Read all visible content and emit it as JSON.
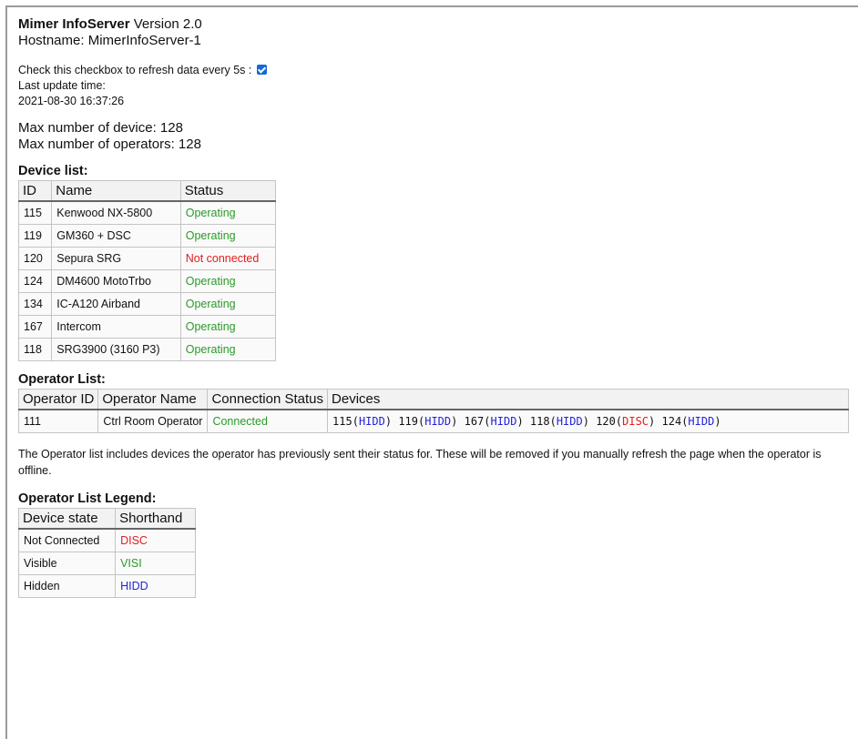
{
  "header": {
    "product": "Mimer InfoServer",
    "version": "Version 2.0",
    "hostname": "Hostname: MimerInfoServer-1"
  },
  "refresh": {
    "label": "Check this checkbox to refresh data every 5s :",
    "checked": true,
    "last_update_label": "Last update time:",
    "last_update_value": "2021-08-30 16:37:26"
  },
  "limits": {
    "max_devices": "Max number of device: 128",
    "max_operators": "Max number of operators: 128"
  },
  "device_list": {
    "title": "Device list:",
    "headers": [
      "ID",
      "Name",
      "Status"
    ],
    "rows": [
      {
        "id": "115",
        "name": "Kenwood NX-5800",
        "status": "Operating",
        "state": "ok"
      },
      {
        "id": "119",
        "name": "GM360 + DSC",
        "status": "Operating",
        "state": "ok"
      },
      {
        "id": "120",
        "name": "Sepura SRG",
        "status": "Not connected",
        "state": "bad"
      },
      {
        "id": "124",
        "name": "DM4600 MotoTrbo",
        "status": "Operating",
        "state": "ok"
      },
      {
        "id": "134",
        "name": "IC-A120 Airband",
        "status": "Operating",
        "state": "ok"
      },
      {
        "id": "167",
        "name": "Intercom",
        "status": "Operating",
        "state": "ok"
      },
      {
        "id": "118",
        "name": "SRG3900 (3160 P3)",
        "status": "Operating",
        "state": "ok"
      }
    ]
  },
  "operator_list": {
    "title": "Operator List:",
    "headers": [
      "Operator ID",
      "Operator Name",
      "Connection Status",
      "Devices"
    ],
    "rows": [
      {
        "id": "111",
        "name": "Ctrl Room Operator",
        "status": "Connected",
        "devices": [
          {
            "id": "115",
            "state": "HIDD"
          },
          {
            "id": "119",
            "state": "HIDD"
          },
          {
            "id": "167",
            "state": "HIDD"
          },
          {
            "id": "118",
            "state": "HIDD"
          },
          {
            "id": "120",
            "state": "DISC"
          },
          {
            "id": "124",
            "state": "HIDD"
          }
        ]
      }
    ]
  },
  "note": "The Operator list includes devices the operator has previously sent their status for. These will be removed if you manually refresh the page when the operator is offline.",
  "legend": {
    "title": "Operator List Legend:",
    "headers": [
      "Device state",
      "Shorthand"
    ],
    "rows": [
      {
        "state": "Not Connected",
        "short": "DISC",
        "cls": "disc"
      },
      {
        "state": "Visible",
        "short": "VISI",
        "cls": "visi"
      },
      {
        "state": "Hidden",
        "short": "HIDD",
        "cls": "hidd"
      }
    ]
  },
  "colors": {
    "operating": "#2a9a2a",
    "not_connected": "#e02020",
    "hidden": "#2323d8",
    "checkbox": "#1668d6"
  }
}
